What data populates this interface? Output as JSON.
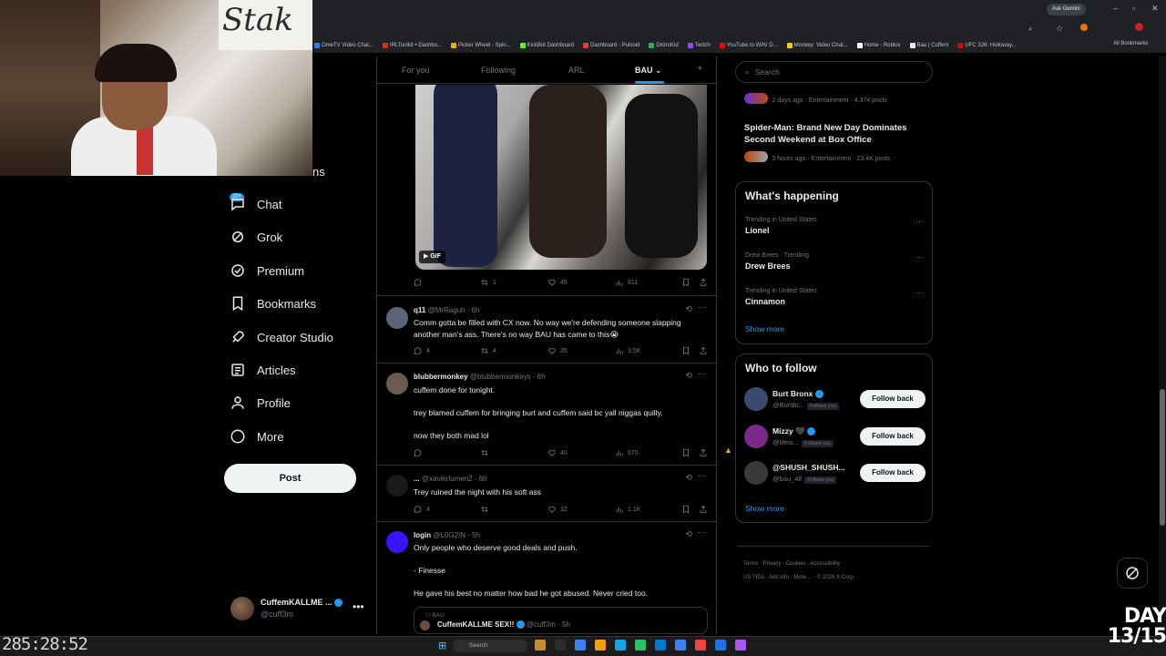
{
  "browser": {
    "ask_gemini": "Ask Gemini",
    "bookmarks": [
      {
        "label": "OmeTV Video Chat...",
        "color": "#2b7de9"
      },
      {
        "label": "IRLToolkit • Dashbo...",
        "color": "#d93025"
      },
      {
        "label": "Picker Wheel - Spin...",
        "color": "#f9ab00"
      },
      {
        "label": "KickBot Dashboard",
        "color": "#53fc18"
      },
      {
        "label": "Dashboard - Pulsoid",
        "color": "#e53935"
      },
      {
        "label": "DistroKid",
        "color": "#34a853"
      },
      {
        "label": "Twitch",
        "color": "#9146ff"
      },
      {
        "label": "YouTube to WAV D...",
        "color": "#ff0000"
      },
      {
        "label": "Monkey: Video Chat...",
        "color": "#ffcc00"
      },
      {
        "label": "Home - Roblox",
        "color": "#ffffff"
      },
      {
        "label": "Bau | Cuffem",
        "color": "#e7e9ea"
      },
      {
        "label": "UFC 326: Holloway...",
        "color": "#d20a0a"
      }
    ],
    "all_bookmarks": "All Bookmarks"
  },
  "webcam": {
    "sign_text": "Stak"
  },
  "nav": {
    "partial_label": "ns",
    "chat_badge": "20+",
    "items": [
      {
        "label": "Chat",
        "icon": "chat-icon"
      },
      {
        "label": "Grok",
        "icon": "grok-icon"
      },
      {
        "label": "Premium",
        "icon": "premium-icon"
      },
      {
        "label": "Bookmarks",
        "icon": "bookmark-icon"
      },
      {
        "label": "Creator Studio",
        "icon": "rocket-icon"
      },
      {
        "label": "Articles",
        "icon": "articles-icon"
      },
      {
        "label": "Profile",
        "icon": "profile-icon"
      },
      {
        "label": "More",
        "icon": "more-icon"
      }
    ],
    "post_label": "Post",
    "account": {
      "name": "CuffemKALLME ...",
      "handle": "@cuff3m"
    }
  },
  "feed": {
    "tabs": [
      "For you",
      "Following",
      "ARL",
      "BAU"
    ],
    "active_tab": "BAU",
    "gif_badge": "GIF",
    "gif_post_stats": {
      "reposts": "1",
      "likes": "45",
      "views": "811"
    },
    "posts": [
      {
        "name": "q11",
        "handle": "@MrRaguh · 6h",
        "text": "Comm gotta be filled with CX now. No way we're defending someone slapping another man's ass. There's no way BAU has came to this😭",
        "replies": "4",
        "reposts": "4",
        "likes": "35",
        "views": "3.5K",
        "avatar": "#5b6478"
      },
      {
        "name": "blubbermonkey",
        "handle": "@blubbermonkeys · 6h",
        "text_lines": [
          "cuffem done for tonight.",
          "",
          "trey blamed cuffem for bringing burt and cuffem said bc yall niggas quilly.",
          "",
          "now they both mad lol"
        ],
        "replies": "",
        "reposts": "",
        "likes": "40",
        "views": "670",
        "avatar": "#6a5a52"
      },
      {
        "name": "...",
        "handle": "@xavierlumen2 · 6h",
        "text": "Trey ruined the night with his soft ass",
        "replies": "4",
        "reposts": "",
        "likes": "32",
        "views": "1.1K",
        "avatar": "#1a1a1a"
      },
      {
        "name": "login",
        "handle": "@L0G2IN · 5h",
        "text_lines": [
          "Only people who deserve good deals and push.",
          "",
          "- Finesse",
          "",
          "He gave his best no matter how bad he got abused. Never cried too."
        ],
        "quote_label": "BAU",
        "quote_name": "CuffemKALLME SEX!!",
        "quote_handle": "@cuff3m · 5h",
        "avatar": "#3b12ff"
      }
    ]
  },
  "right": {
    "search_placeholder": "Search",
    "top_trends": [
      {
        "meta": "2 days ago · Entertainment · 4,374 posts",
        "title": ""
      },
      {
        "meta": "3 hours ago · Entertainment · 23.4K posts",
        "title": "Spider-Man: Brand New Day Dominates Second Weekend at Box Office"
      }
    ],
    "whats_happening": {
      "heading": "What's happening",
      "trends": [
        {
          "meta": "Trending in United States",
          "title": "Lionel"
        },
        {
          "meta": "Drew Brees · Trending",
          "title": "Drew Brees"
        },
        {
          "meta": "Trending in United States",
          "title": "Cinnamon"
        }
      ],
      "show_more": "Show more"
    },
    "who_to_follow": {
      "heading": "Who to follow",
      "users": [
        {
          "name": "Burt Bronx",
          "handle": "@BurtBr...",
          "follows_you": "Follows you",
          "button": "Follow back",
          "avatar": "#3c4a6e"
        },
        {
          "name": "Mizzy 🖤",
          "handle": "@lifeis...",
          "follows_you": "Follows you",
          "button": "Follow back",
          "avatar": "#7b2a8a"
        },
        {
          "name": "@SHUSH_SHUSH...",
          "handle": "@bau_4lf",
          "follows_you": "Follows you",
          "button": "Follow back",
          "avatar": "#3a3a3a"
        }
      ],
      "show_more": "Show more"
    },
    "footer_line1": [
      "Terms",
      "Privacy",
      "Cookies",
      "Accessibility"
    ],
    "footer_line2": [
      "US TIDA",
      "Ads info",
      "More ...",
      "© 2026 X Corp."
    ]
  },
  "overlay": {
    "timer": "285:28:52",
    "day_line1": "DAY",
    "day_line2": "13/15"
  },
  "taskbar": {
    "search": "Search"
  }
}
